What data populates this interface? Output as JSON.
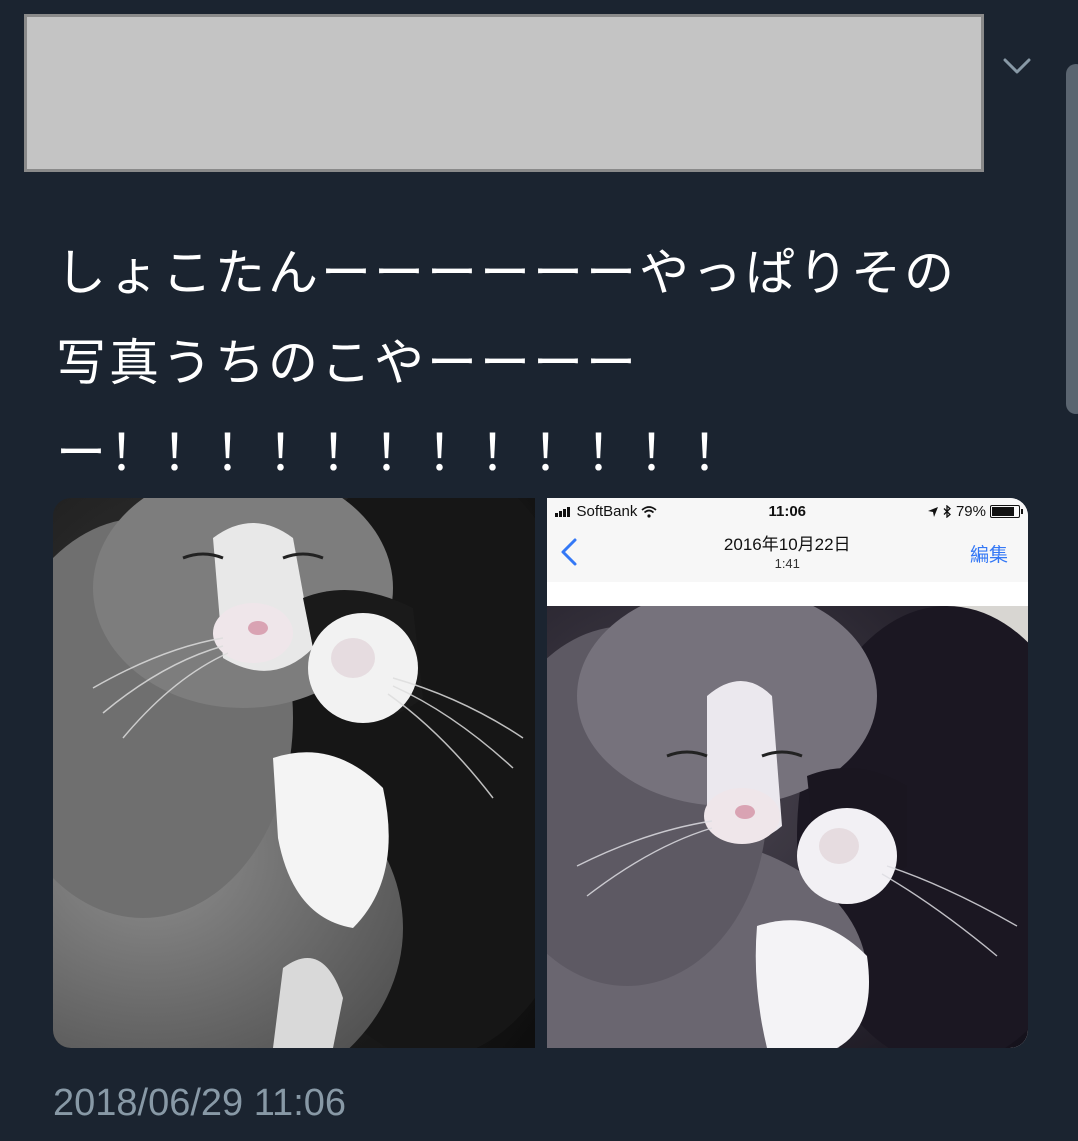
{
  "tweet": {
    "text_lines": [
      "しょこたんーーーーーーやっぱりその",
      "写真うちのこやーーーー",
      "ー！！！！！！！！！！！！"
    ],
    "timestamp": "2018/06/29 11:06"
  },
  "media": {
    "left_image": {
      "subject": "cats-photo"
    },
    "right_image": {
      "status_bar": {
        "carrier": "SoftBank",
        "time": "11:06",
        "battery": "79%",
        "battery_level": 0.79
      },
      "nav": {
        "title": "2016年10月22日",
        "subtitle": "1:41",
        "edit_label": "編集"
      }
    }
  },
  "colors": {
    "background": "#1b2430",
    "text": "#ffffff",
    "timestamp": "#8899a6",
    "ios_link": "#3478f6"
  },
  "icons": {
    "menu": "chevron-down-icon",
    "signal": "signal-icon",
    "wifi": "wifi-icon",
    "location": "location-arrow-icon",
    "bluetooth": "bluetooth-icon",
    "battery": "battery-icon",
    "back": "chevron-left-icon"
  }
}
